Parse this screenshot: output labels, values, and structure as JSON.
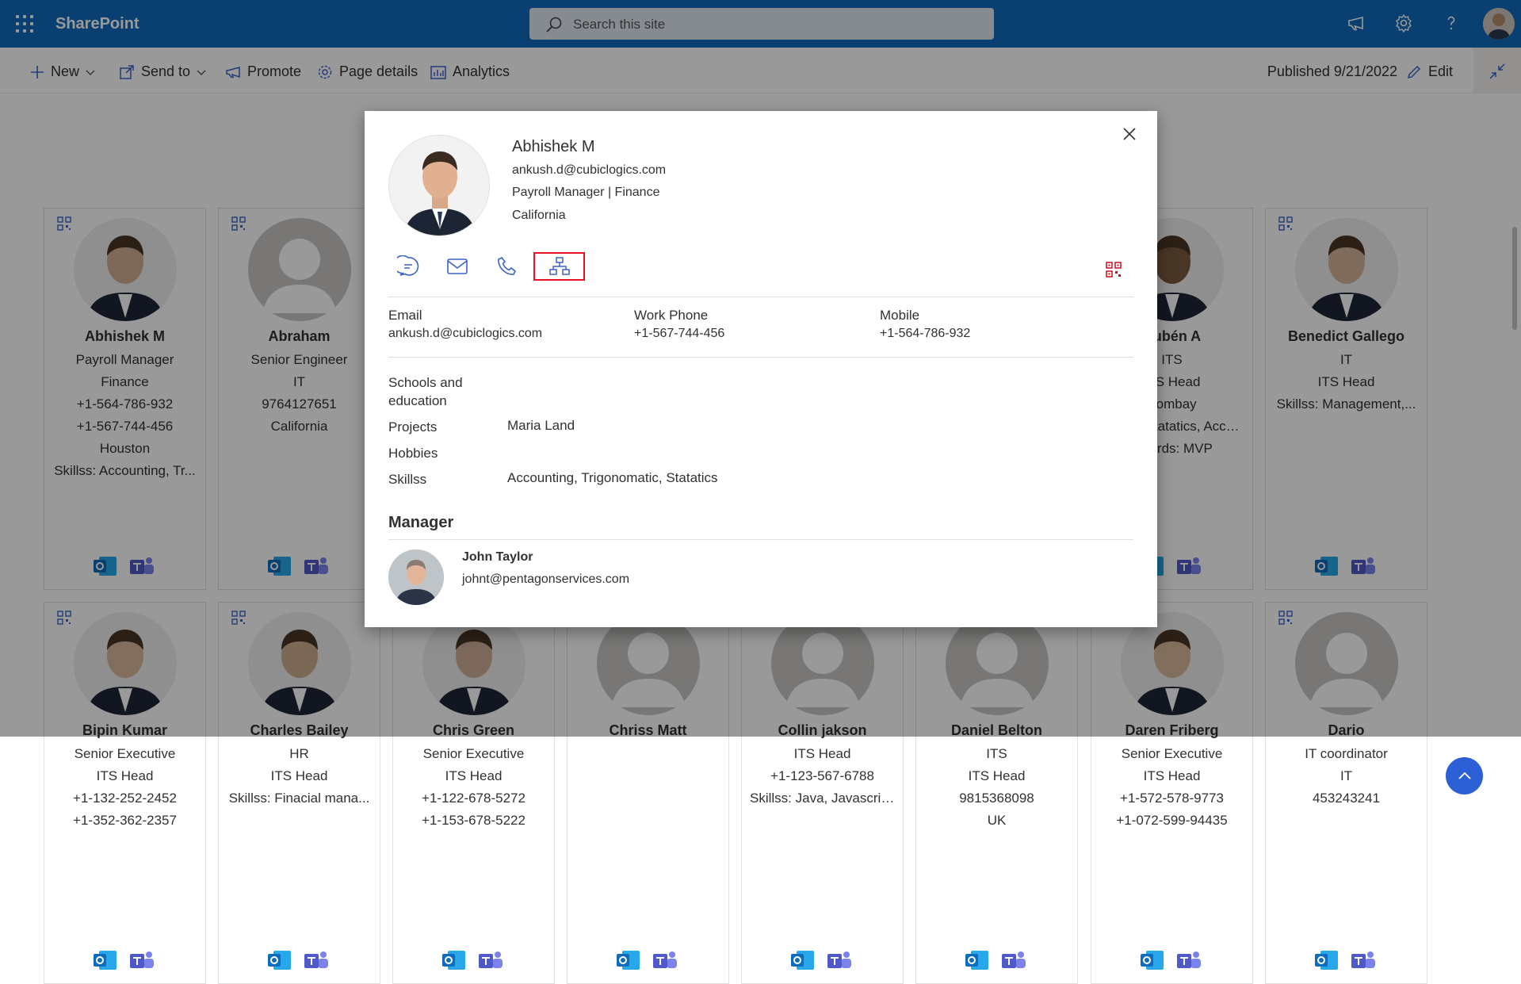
{
  "topbar": {
    "app_name": "SharePoint",
    "search_placeholder": "Search this site"
  },
  "commandbar": {
    "new": "New",
    "send_to": "Send to",
    "promote": "Promote",
    "page_details": "Page details",
    "analytics": "Analytics",
    "published": "Published 9/21/2022",
    "edit": "Edit"
  },
  "cards": [
    {
      "name": "Abhishek M",
      "lines": [
        "Payroll Manager",
        "Finance",
        "+1-564-786-932",
        "+1-567-744-456",
        "Houston",
        "Skillss: Accounting, Tr..."
      ]
    },
    {
      "name": "Abraham",
      "lines": [
        "Senior Engineer",
        "IT",
        "9764127651",
        "California"
      ]
    },
    {
      "name": "Rubén A",
      "lines": [
        "ITS",
        "ITS Head",
        "Bombay",
        "Skillss: Statatics, Acco...",
        "Awards: MVP"
      ]
    },
    {
      "name": "Benedict Gallego",
      "lines": [
        "IT",
        "ITS Head",
        "Skillss: Management,..."
      ]
    },
    {
      "name": "Bipin Kumar",
      "lines": [
        "Senior Executive",
        "ITS Head",
        "+1-132-252-2452",
        "+1-352-362-2357"
      ]
    },
    {
      "name": "Charles Bailey",
      "lines": [
        "HR",
        "ITS Head",
        "Skillss: Finacial mana..."
      ]
    },
    {
      "name": "Chris Green",
      "lines": [
        "Senior Executive",
        "ITS Head",
        "+1-122-678-5272",
        "+1-153-678-5222"
      ]
    },
    {
      "name": "Chriss Matt",
      "lines": []
    },
    {
      "name": "Collin jakson",
      "lines": [
        "ITS Head",
        "+1-123-567-6788",
        "Skillss: Java, Javascrip..."
      ]
    },
    {
      "name": "Daniel Belton",
      "lines": [
        "ITS",
        "ITS Head",
        "9815368098",
        "UK"
      ]
    },
    {
      "name": "Daren Friberg",
      "lines": [
        "Senior Executive",
        "ITS Head",
        "+1-572-578-9773",
        "+1-072-599-94435"
      ]
    },
    {
      "name": "Dario",
      "lines": [
        "IT coordinator",
        "IT",
        "453243241"
      ]
    }
  ],
  "modal": {
    "name": "Abhishek M",
    "email": "ankush.d@cubiclogics.com",
    "title_dept": "Payroll Manager | Finance",
    "location": "California",
    "fields": [
      {
        "label": "Email",
        "value": "ankush.d@cubiclogics.com"
      },
      {
        "label": "Work Phone",
        "value": "+1-567-744-456"
      },
      {
        "label": "Mobile",
        "value": "+1-564-786-932"
      }
    ],
    "profile": [
      {
        "label": "Schools and education",
        "value": ""
      },
      {
        "label": "Projects",
        "value": "Maria Land"
      },
      {
        "label": "Hobbies",
        "value": ""
      },
      {
        "label": "Skillss",
        "value": "Accounting, Trigonomatic, Statatics"
      }
    ],
    "manager_heading": "Manager",
    "manager": {
      "name": "John Taylor",
      "email": "johnt@pentagonservices.com"
    }
  },
  "colors": {
    "suite_bar": "#0f6cbd",
    "accent": "#2d5fd6",
    "selected_outline": "#e81123",
    "qr": "#c50f1f"
  }
}
